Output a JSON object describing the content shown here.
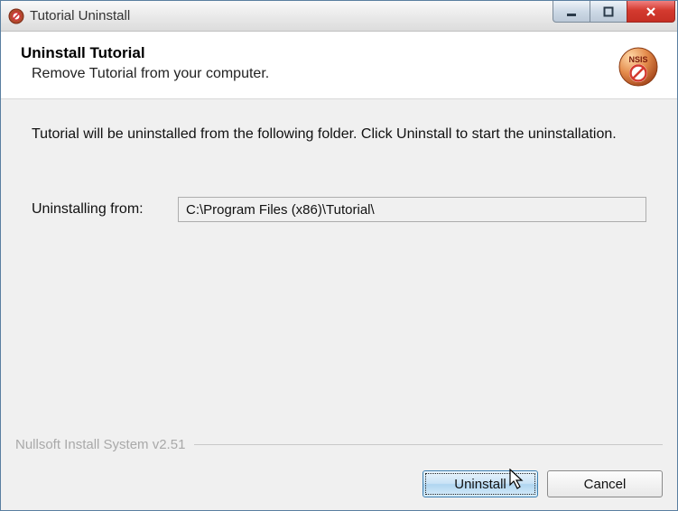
{
  "window": {
    "title": "Tutorial Uninstall"
  },
  "header": {
    "title": "Uninstall Tutorial",
    "subtitle": "Remove Tutorial from your computer."
  },
  "main": {
    "description": "Tutorial will be uninstalled from the following folder. Click Uninstall to start the uninstallation.",
    "path_label": "Uninstalling from:",
    "path_value": "C:\\Program Files (x86)\\Tutorial\\"
  },
  "footer": {
    "brand": "Nullsoft Install System v2.51",
    "uninstall": "Uninstall",
    "cancel": "Cancel"
  }
}
